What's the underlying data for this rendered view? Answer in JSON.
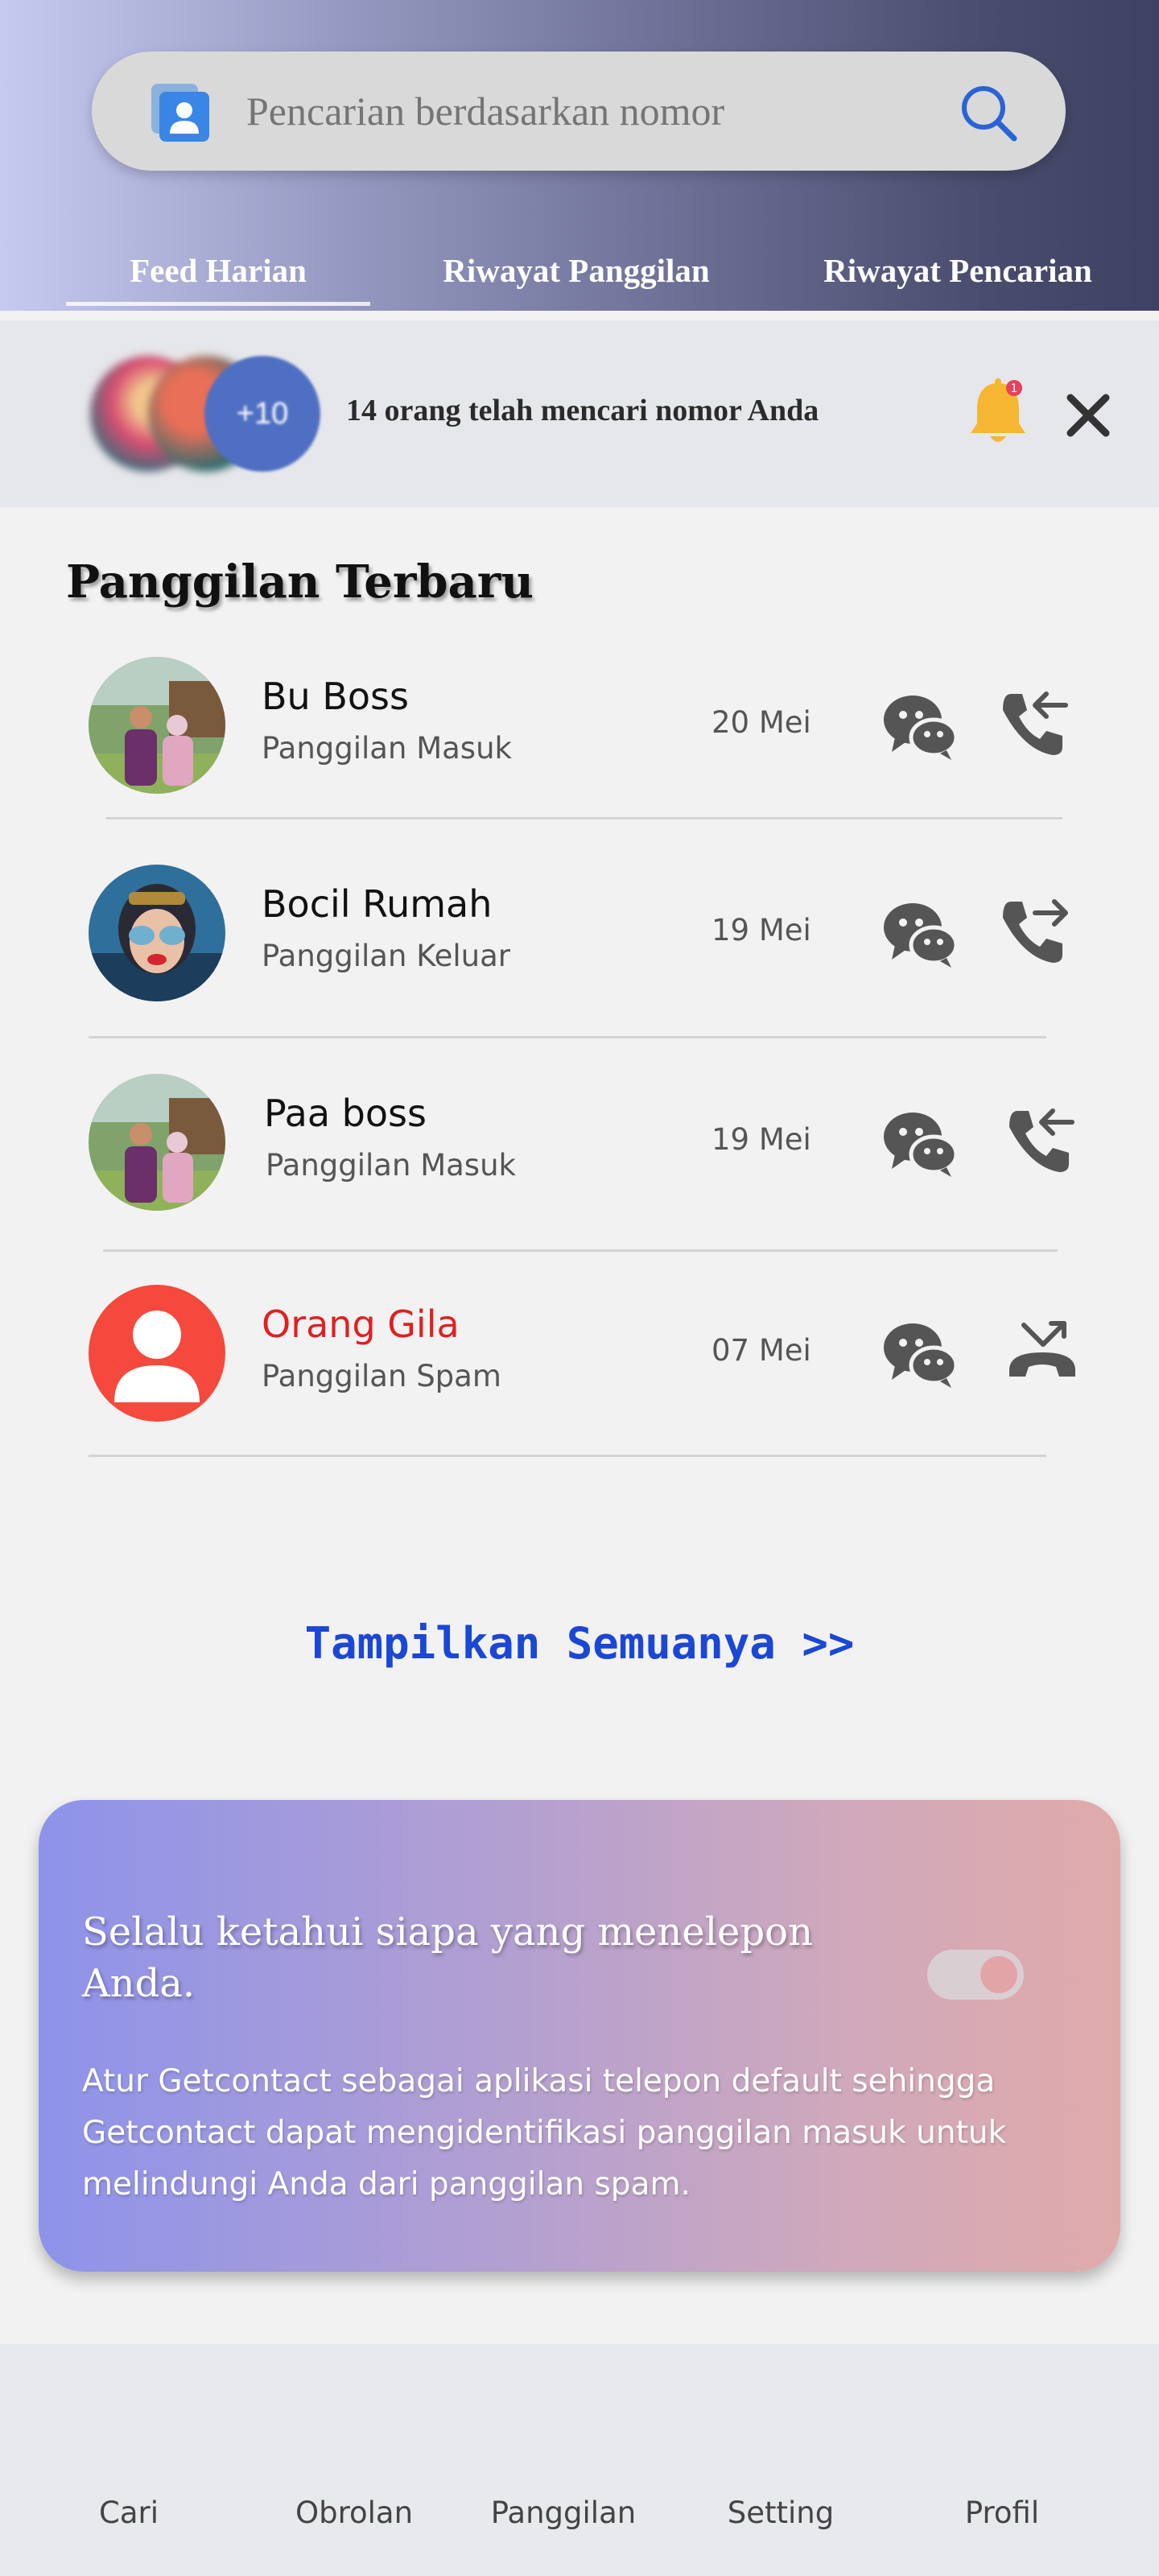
{
  "search": {
    "placeholder": "Pencarian berdasarkan nomor",
    "left_icon": "contact-card-icon",
    "right_icon": "search-icon"
  },
  "tabs": [
    {
      "label": "Feed Harian",
      "active": true
    },
    {
      "label": "Riwayat Panggilan",
      "active": false
    },
    {
      "label": "Riwayat Pencarian",
      "active": false
    }
  ],
  "banner": {
    "stack_count": "+10",
    "count": "14",
    "text": "orang telah mencari nomor Anda",
    "bell_icon": "bell-icon",
    "bell_badge": "1",
    "close_icon": "close-icon"
  },
  "recent": {
    "title": "Panggilan Terbaru",
    "calls": [
      {
        "name": "Bu Boss",
        "type": "Panggilan Masuk",
        "date": "20 Mei",
        "direction": "incoming",
        "spam": false
      },
      {
        "name": "Bocil Rumah",
        "type": "Panggilan Keluar",
        "date": "19 Mei",
        "direction": "outgoing",
        "spam": false
      },
      {
        "name": "Paa boss",
        "type": "Panggilan Masuk",
        "date": "19 Mei",
        "direction": "incoming",
        "spam": false
      },
      {
        "name": "Orang Gila",
        "type": "Panggilan Spam",
        "date": "07 Mei",
        "direction": "rejected",
        "spam": true
      }
    ],
    "show_all": "Tampilkan Semuanya >>"
  },
  "promo": {
    "title": "Selalu ketahui siapa yang menelepon Anda.",
    "description": "Atur Getcontact sebagai aplikasi telepon default sehingga Getcontact dapat mengidentifikasi panggilan masuk untuk melindungi Anda dari panggilan spam.",
    "toggle_on": true
  },
  "colors": {
    "spam": "#e02020",
    "link": "#1a47d6",
    "spam_avatar": "#f4493c",
    "bell": "#f5b731"
  },
  "nav": [
    "Cari",
    "Obrolan",
    "Panggilan",
    "Setting",
    "Profil"
  ]
}
